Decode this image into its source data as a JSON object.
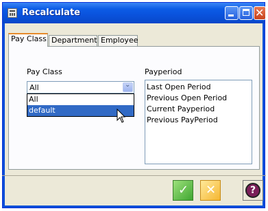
{
  "window": {
    "title": "Recalculate",
    "icons": {
      "app": "calculator-icon",
      "minimize": "minimize-icon",
      "maximize": "maximize-icon",
      "close": "close-icon"
    }
  },
  "tabs": [
    {
      "label": "Pay Class",
      "active": true
    },
    {
      "label": "Department",
      "active": false
    },
    {
      "label": "Employee",
      "active": false
    }
  ],
  "pay_class": {
    "label": "Pay Class",
    "selected": "All",
    "options": [
      "All",
      "default"
    ],
    "highlighted": "default"
  },
  "payperiod": {
    "label": "Payperiod",
    "items": [
      "Last Open Period",
      "Previous Open Period",
      "Current Payperiod",
      "Previous PayPeriod"
    ]
  },
  "buttons": {
    "ok_icon": "check-icon",
    "cancel_icon": "x-icon",
    "help_glyph": "?"
  }
}
